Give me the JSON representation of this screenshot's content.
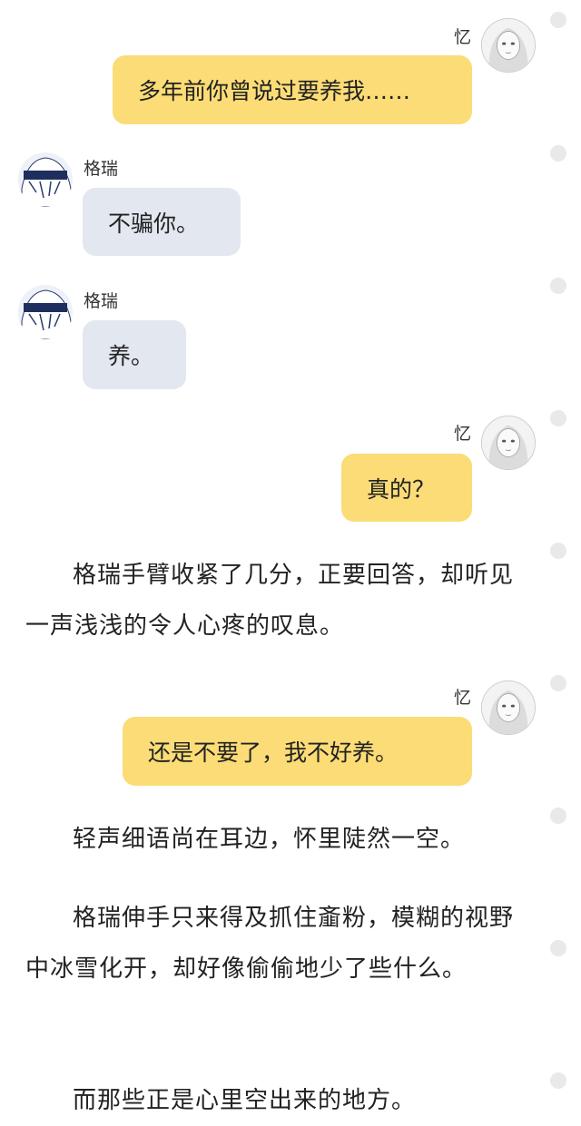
{
  "chat": {
    "msg1": {
      "sender": "忆",
      "text": "多年前你曾说过要养我……"
    },
    "msg2": {
      "sender": "格瑞",
      "text": "不骗你。"
    },
    "msg3": {
      "sender": "格瑞",
      "text": "养。"
    },
    "msg4": {
      "sender": "忆",
      "text": "真的？"
    },
    "narration1": "格瑞手臂收紧了几分，正要回答，却听见一声浅浅的令人心疼的叹息。",
    "msg5": {
      "sender": "忆",
      "text": "还是不要了，我不好养。"
    },
    "narration2": "轻声细语尚在耳边，怀里陡然一空。",
    "narration3": "格瑞伸手只来得及抓住齑粉，模糊的视野中冰雪化开，却好像偷偷地少了些什么。",
    "narration4": "而那些正是心里空出来的地方。"
  },
  "colors": {
    "yellow_bubble": "#fbdc76",
    "grey_bubble": "#e2e7f0",
    "dot": "#e9e9e9"
  }
}
